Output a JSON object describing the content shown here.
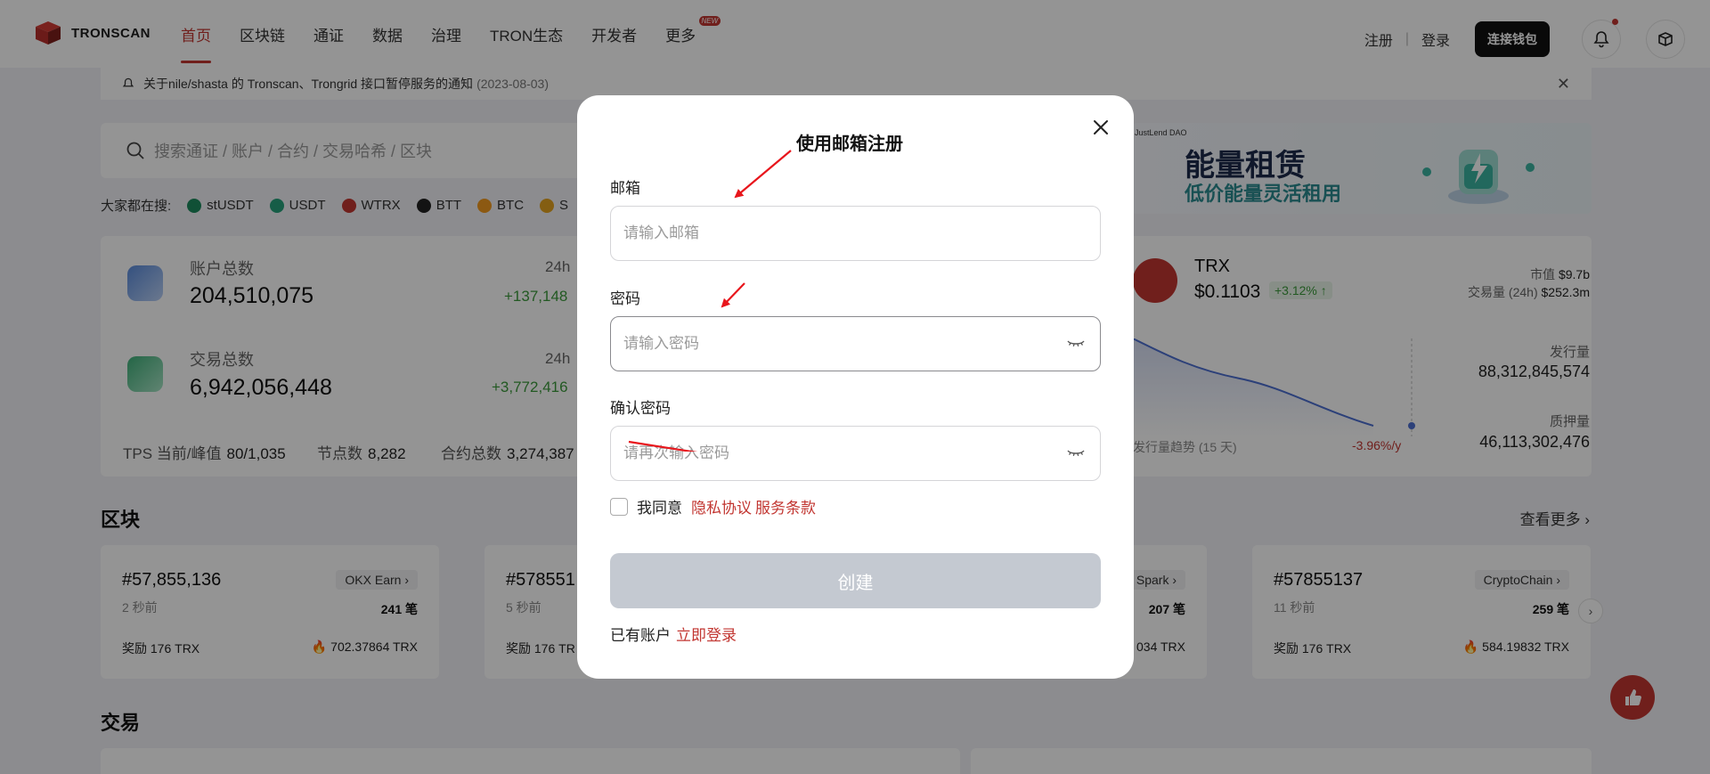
{
  "brand": {
    "name": "TRONSCAN"
  },
  "nav": {
    "items": [
      "首页",
      "区块链",
      "通证",
      "数据",
      "治理",
      "TRON生态",
      "开发者",
      "更多"
    ],
    "new_badge": "NEW"
  },
  "header": {
    "register": "注册",
    "separator": "|",
    "login": "登录",
    "connect_wallet": "连接钱包"
  },
  "notice": {
    "text": "关于nile/shasta 的 Tronscan、Trongrid 接口暂停服务的通知",
    "date": "(2023-08-03)",
    "close": "✕"
  },
  "search": {
    "placeholder": "搜索通证 / 账户 / 合约 / 交易哈希 / 区块"
  },
  "hot_search": {
    "label": "大家都在搜:",
    "tokens": [
      "stUSDT",
      "USDT",
      "WTRX",
      "BTT",
      "BTC",
      "S"
    ]
  },
  "banner": {
    "tag": "JustLend DAO",
    "title": "能量租赁",
    "subtitle": "低价能量灵活租用"
  },
  "stats": {
    "accounts_label": "账户总数",
    "accounts_value": "204,510,075",
    "accounts_24h": "24h",
    "accounts_delta": "+137,148",
    "tx_label": "交易总数",
    "tx_value": "6,942,056,448",
    "tx_24h": "24h",
    "tx_delta": "+3,772,416",
    "tps_label": "TPS 当前/峰值",
    "tps_value": "80/1,035",
    "nodes_label": "节点数",
    "nodes_value": "8,282",
    "contracts_label": "合约总数",
    "contracts_value": "3,274,387"
  },
  "trx": {
    "name": "TRX",
    "price": "$0.1103",
    "change": "+3.12% ↑",
    "market_cap_label": "市值",
    "market_cap_value": "$9.7b",
    "volume_label": "交易量 (24h)",
    "volume_value": "$252.3m",
    "supply_label": "发行量",
    "supply_value": "88,312,845,574",
    "staked_label": "质押量",
    "staked_value": "46,113,302,476",
    "trend_label": "发行量趋势 (15 天)",
    "trend_pct": "-3.96%/y"
  },
  "blocks": {
    "title": "区块",
    "see_more": "查看更多 ›",
    "cards": [
      {
        "num": "#57,855,136",
        "time": "2 秒前",
        "tag": "OKX Earn ›",
        "count": "241 笔",
        "reward": "奖励 176 TRX",
        "burn": "702.37864 TRX"
      },
      {
        "num": "#578551",
        "time": "5 秒前",
        "tag": "",
        "count": "",
        "reward": "奖励 176 TR",
        "burn": ""
      },
      {
        "num": "",
        "time": "",
        "tag": "Spark ›",
        "count": "207 笔",
        "reward": "",
        "burn": "034 TRX"
      },
      {
        "num": "#57855137",
        "time": "11 秒前",
        "tag": "CryptoChain ›",
        "count": "259 笔",
        "reward": "奖励 176 TRX",
        "burn": "584.19832 TRX"
      }
    ],
    "next": "›"
  },
  "transactions": {
    "title": "交易"
  },
  "modal": {
    "annotation": "使用邮箱注册",
    "email_label": "邮箱",
    "email_placeholder": "请输入邮箱",
    "password_label": "密码",
    "password_placeholder": "请输入密码",
    "confirm_label": "确认密码",
    "confirm_placeholder": "请再次输入密码",
    "agree_text": "我同意",
    "privacy_link": "隐私协议",
    "terms_link": "服务条款",
    "create_button": "创建",
    "have_account": "已有账户",
    "login_now": "立即登录"
  },
  "colors": {
    "brand_red": "#c23631",
    "disabled_button": "#c4c9d1",
    "overlay": "rgba(0,0,0,0.42)",
    "annotation_arrow": "#e8161c"
  },
  "icons": {
    "logo": "tronscan-cube-logo",
    "bell": "bell-icon",
    "box": "box-icon",
    "search": "search-icon",
    "close": "close-icon",
    "eye": "eye-closed-icon",
    "arrow": "red-annotation-arrow"
  }
}
